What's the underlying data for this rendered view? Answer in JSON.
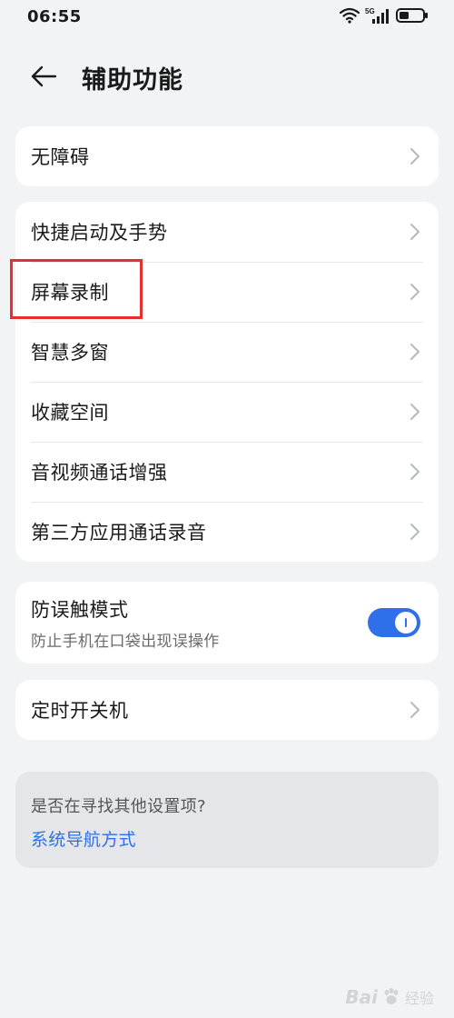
{
  "status": {
    "time": "06:55",
    "network": "5G",
    "icons": [
      "wifi-icon",
      "signal-icon",
      "battery-icon"
    ]
  },
  "header": {
    "back_icon": "back-arrow-icon",
    "title": "辅助功能"
  },
  "groups": {
    "g1": [
      {
        "label": "无障碍"
      }
    ],
    "g2": [
      {
        "label": "快捷启动及手势"
      },
      {
        "label": "屏幕录制"
      },
      {
        "label": "智慧多窗"
      },
      {
        "label": "收藏空间"
      },
      {
        "label": "音视频通话增强"
      },
      {
        "label": "第三方应用通话录音"
      }
    ],
    "g3": {
      "title": "防误触模式",
      "subtitle": "防止手机在口袋出现误操作",
      "enabled": true
    },
    "g4": [
      {
        "label": "定时开关机"
      }
    ]
  },
  "suggestion": {
    "question": "是否在寻找其他设置项?",
    "link": "系统导航方式"
  },
  "watermark": {
    "brand": "Bai",
    "suffix": "经验"
  },
  "colors": {
    "accent": "#2f6fe8",
    "highlight": "#e33030",
    "background": "#f1f3f5"
  }
}
